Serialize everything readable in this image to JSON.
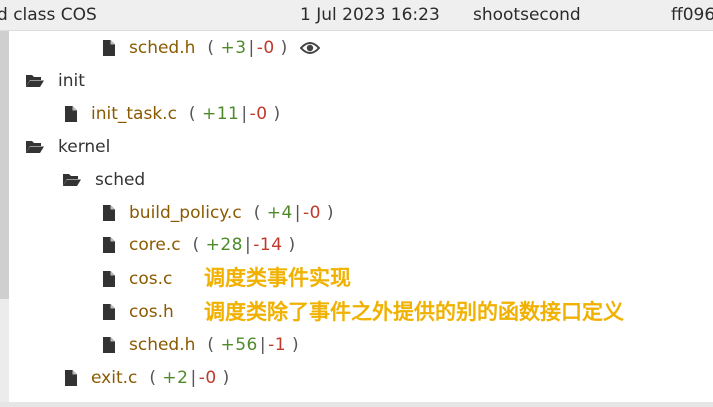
{
  "header": {
    "subject": "d class COS",
    "date": "1 Jul 2023 16:23",
    "author": "shootsecond",
    "hash": "ff096"
  },
  "tree": {
    "sched_h_top": {
      "name": "sched.h",
      "add": "+3",
      "del": "-0",
      "open": "(",
      "sep": "|",
      "close": ")"
    },
    "init_folder": {
      "name": "init"
    },
    "init_task": {
      "name": "init_task.c",
      "add": "+11",
      "del": "-0",
      "open": "(",
      "sep": "|",
      "close": ")"
    },
    "kernel_folder": {
      "name": "kernel"
    },
    "sched_folder": {
      "name": "sched"
    },
    "build_policy": {
      "name": "build_policy.c",
      "add": "+4",
      "del": "-0",
      "open": "(",
      "sep": "|",
      "close": ")"
    },
    "core_c": {
      "name": "core.c",
      "add": "+28",
      "del": "-14",
      "open": "(",
      "sep": "|",
      "close": ")"
    },
    "cos_c": {
      "name": "cos.c"
    },
    "cos_h": {
      "name": "cos.h"
    },
    "sched_h": {
      "name": "sched.h",
      "add": "+56",
      "del": "-1",
      "open": "(",
      "sep": "|",
      "close": ")"
    },
    "exit_c": {
      "name": "exit.c",
      "add": "+2",
      "del": "-0",
      "open": "(",
      "sep": "|",
      "close": ")"
    }
  },
  "annotations": {
    "cos_c_note": "调度类事件实现",
    "cos_h_note": "调度类除了事件之外提供的别的函数接口定义"
  },
  "colors": {
    "add": "#4f8a2a",
    "del": "#c0392b",
    "file": "#8a5a00",
    "annotation": "#f0b100"
  },
  "icons": {
    "file": "file-icon",
    "folder": "folder-open-icon",
    "eye": "eye-icon"
  }
}
